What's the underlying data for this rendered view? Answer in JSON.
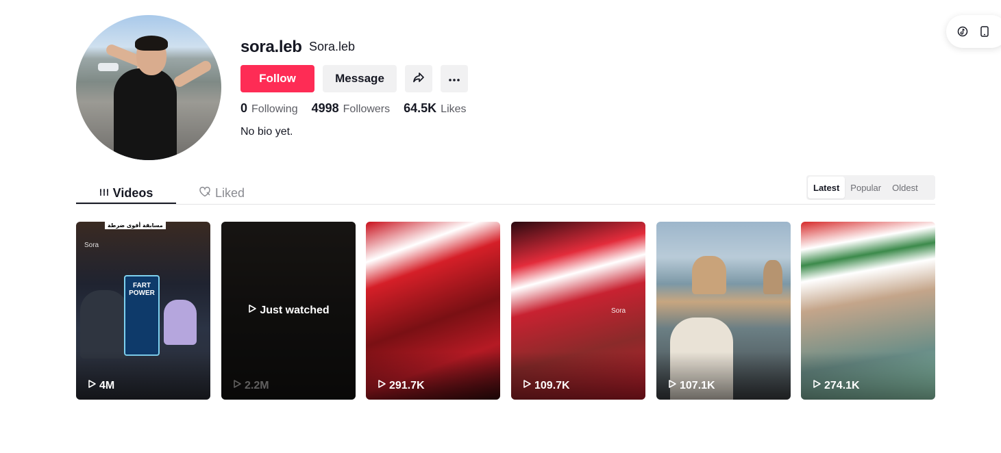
{
  "profile": {
    "username": "sora.leb",
    "nickname": "Sora.leb",
    "bio": "No bio yet.",
    "follow_label": "Follow",
    "message_label": "Message",
    "stats": {
      "following_count": "0",
      "following_label": "Following",
      "followers_count": "4998",
      "followers_label": "Followers",
      "likes_count": "64.5K",
      "likes_label": "Likes"
    }
  },
  "tabs": {
    "videos_label": "Videos",
    "liked_label": "Liked"
  },
  "sort": {
    "options": [
      "Latest",
      "Popular",
      "Oldest"
    ],
    "selected": "Latest"
  },
  "videos": [
    {
      "views": "4M",
      "overlay_text": "مسابقة أقوى ضرطة",
      "watermark": "Sora",
      "sign_text": "FART POWER"
    },
    {
      "views": "2.2M",
      "badge": "Just watched"
    },
    {
      "views": "291.7K"
    },
    {
      "views": "109.7K",
      "watermark": "Sora"
    },
    {
      "views": "107.1K"
    },
    {
      "views": "274.1K"
    }
  ],
  "colors": {
    "accent": "#fe2c55",
    "text_primary": "#161823",
    "text_secondary": "#5b5c63",
    "button_gray": "#f1f1f2"
  },
  "icons": {
    "share": "share-arrow-icon",
    "more": "ellipsis-icon",
    "videos_tab": "grid-lines-icon",
    "liked_tab": "heart-outline-icon",
    "play": "play-outline-icon",
    "tiktok": "tiktok-logo-icon",
    "phone": "mobile-phone-icon"
  }
}
